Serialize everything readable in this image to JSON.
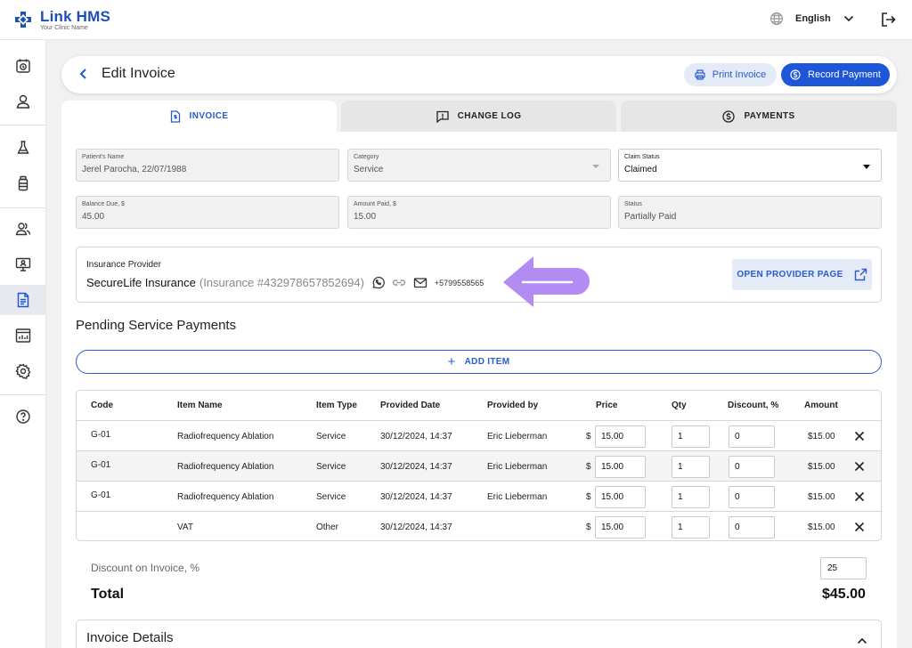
{
  "app": {
    "name": "Link HMS",
    "subtitle": "Your Clinic Name"
  },
  "header": {
    "language": "English",
    "icons": [
      "globe-icon",
      "chevron-down-icon",
      "logout-icon"
    ]
  },
  "sidebar": {
    "items": [
      "calendar-icon",
      "user-icon",
      "lab-flask-icon",
      "medicine-bottle-icon",
      "patients-icon",
      "monitor-icon",
      "invoice-icon",
      "reports-icon",
      "settings-icon",
      "help-icon"
    ],
    "active": "invoice-icon"
  },
  "page": {
    "title": "Edit Invoice",
    "print_label": "Print Invoice",
    "record_label": "Record Payment"
  },
  "tabs": [
    {
      "label": "INVOICE",
      "icon": "invoice-doc-icon",
      "active": true
    },
    {
      "label": "CHANGE LOG",
      "icon": "comment-alert-icon",
      "active": false
    },
    {
      "label": "PAYMENTS",
      "icon": "dollar-circle-icon",
      "active": false
    }
  ],
  "form": {
    "patient": {
      "label": "Patient's Name",
      "value": "Jerel Parocha, 22/07/1988"
    },
    "category": {
      "label": "Category",
      "value": "Service"
    },
    "claim_status": {
      "label": "Claim Status",
      "value": "Claimed"
    },
    "balance_due": {
      "label": "Balance Due, $",
      "value": "45.00"
    },
    "amount_paid": {
      "label": "Amount Paid, $",
      "value": "15.00"
    },
    "status": {
      "label": "Status",
      "value": "Partially Paid"
    }
  },
  "insurance": {
    "label": "Insurance Provider",
    "name": "SecureLife Insurance",
    "number": "(Insurance #432978657852694)",
    "phone": "+5799558565",
    "open_label": "OPEN PROVIDER PAGE",
    "icons": [
      "whatsapp-icon",
      "link-icon",
      "mail-icon",
      "external-link-icon"
    ]
  },
  "pending": {
    "title": "Pending Service Payments",
    "add_label": "ADD ITEM",
    "columns": [
      "Code",
      "Item Name",
      "Item Type",
      "Provided Date",
      "Provided by",
      "Price",
      "Qty",
      "Discount, %",
      "Amount"
    ],
    "currency_symbol": "$",
    "rows": [
      {
        "code": "G-01",
        "name": "Radiofrequency Ablation",
        "type": "Service",
        "date": "30/12/2024, 14:37",
        "by": "Eric Lieberman",
        "price": "15.00",
        "qty": "1",
        "discount": "0",
        "amount": "$15.00"
      },
      {
        "code": "G-01",
        "name": "Radiofrequency Ablation",
        "type": "Service",
        "date": "30/12/2024, 14:37",
        "by": "Eric Lieberman",
        "price": "15.00",
        "qty": "1",
        "discount": "0",
        "amount": "$15.00"
      },
      {
        "code": "G-01",
        "name": "Radiofrequency Ablation",
        "type": "Service",
        "date": "30/12/2024, 14:37",
        "by": "Eric Lieberman",
        "price": "15.00",
        "qty": "1",
        "discount": "0",
        "amount": "$15.00"
      },
      {
        "code": "",
        "name": "VAT",
        "type": "Other",
        "date": "30/12/2024, 14:37",
        "by": "",
        "price": "15.00",
        "qty": "1",
        "discount": "0",
        "amount": "$15.00"
      }
    ]
  },
  "summary": {
    "discount_label": "Discount on Invoice, %",
    "discount_value": "25",
    "total_label": "Total",
    "total_value": "$45.00"
  },
  "details": {
    "title": "Invoice Details"
  },
  "colors": {
    "primary": "#1d56d6",
    "brand": "#1e4fb8",
    "accent_light": "#e4ebf7",
    "pointer": "#b28cf2"
  }
}
